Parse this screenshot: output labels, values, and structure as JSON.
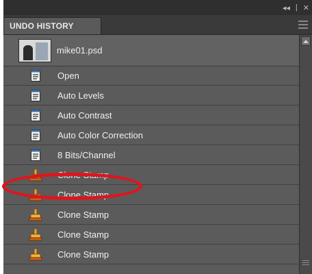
{
  "panel": {
    "controls": {
      "collapse_glyph": "◂◂",
      "separator": "|",
      "close_glyph": "✕"
    },
    "tab_label": "UNDO HISTORY"
  },
  "snapshot": {
    "filename": "mike01.psd",
    "icon": "photo-thumbnail"
  },
  "history": {
    "items": [
      {
        "label": "Open",
        "icon": "document-icon"
      },
      {
        "label": "Auto Levels",
        "icon": "document-icon"
      },
      {
        "label": "Auto Contrast",
        "icon": "document-icon"
      },
      {
        "label": "Auto Color Correction",
        "icon": "document-icon"
      },
      {
        "label": "8 Bits/Channel",
        "icon": "document-icon"
      },
      {
        "label": "Clone Stamp",
        "icon": "clone-stamp-icon",
        "highlighted": true
      },
      {
        "label": "Clone Stamp",
        "icon": "clone-stamp-icon"
      },
      {
        "label": "Clone Stamp",
        "icon": "clone-stamp-icon"
      },
      {
        "label": "Clone Stamp",
        "icon": "clone-stamp-icon"
      },
      {
        "label": "Clone Stamp",
        "icon": "clone-stamp-icon"
      }
    ]
  },
  "colors": {
    "panel_bg": "#535353",
    "row_bg": "#5b5b5b",
    "annotation": "#e1141c"
  }
}
